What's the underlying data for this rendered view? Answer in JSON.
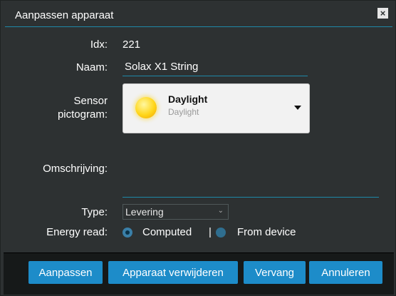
{
  "dialog": {
    "title": "Aanpassen apparaat",
    "close_glyph": "×"
  },
  "fields": {
    "idx_label": "Idx:",
    "idx_value": "221",
    "name_label": "Naam:",
    "name_value": "Solax X1 String",
    "sensor_label_1": "Sensor",
    "sensor_label_2": "pictogram:",
    "sensor_icon": {
      "title": "Daylight",
      "subtitle": "Daylight",
      "icon": "sun-icon"
    },
    "description_label": "Omschrijving:",
    "description_value": "",
    "type_label": "Type:",
    "type_value": "Levering",
    "energy_label": "Energy read:",
    "energy_options": [
      {
        "label": "Computed",
        "checked": true
      },
      {
        "label": "From device",
        "checked": false
      }
    ],
    "separator": "|"
  },
  "buttons": {
    "update": "Aanpassen",
    "delete": "Apparaat verwijderen",
    "replace": "Vervang",
    "cancel": "Annuleren"
  },
  "colors": {
    "accent": "#1e88a8",
    "button": "#1d8cc9",
    "background": "#2d3132"
  }
}
